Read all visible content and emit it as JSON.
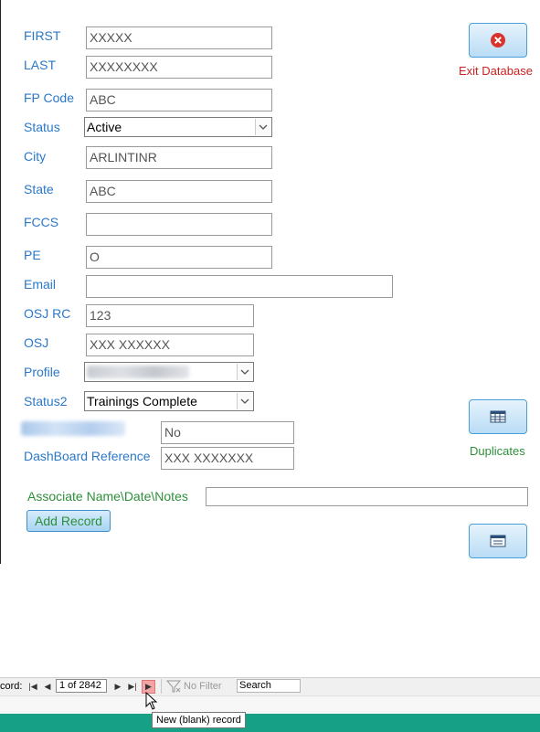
{
  "form": {
    "first": {
      "label": "FIRST",
      "value": "XXXXX"
    },
    "last": {
      "label": "LAST",
      "value": "XXXXXXXX"
    },
    "fp_code": {
      "label": "FP Code",
      "value": "ABC"
    },
    "status": {
      "label": "Status",
      "value": "Active"
    },
    "city": {
      "label": "City",
      "value": "ARLINTINR"
    },
    "state": {
      "label": "State",
      "value": "ABC"
    },
    "fccs": {
      "label": "FCCS",
      "value": ""
    },
    "pe": {
      "label": "PE",
      "value": "O"
    },
    "email": {
      "label": "Email",
      "value": ""
    },
    "osj_rc": {
      "label": "OSJ RC",
      "value": "123"
    },
    "osj": {
      "label": "OSJ",
      "value": "XXX XXXXXX"
    },
    "profile": {
      "label": "Profile",
      "value": ""
    },
    "status2": {
      "label": "Status2",
      "value": "Trainings Complete"
    },
    "blurred_field": {
      "value": "No"
    },
    "dashboard_reference": {
      "label": "DashBoard Reference",
      "value": "XXX XXXXXXX"
    },
    "associate_notes": {
      "label": "Associate Name\\Date\\Notes",
      "value": ""
    }
  },
  "buttons": {
    "exit_caption": "Exit Database",
    "duplicates_caption": "Duplicates",
    "add_record": "Add Record"
  },
  "navigation": {
    "record_label": "cord:",
    "position": "1 of 2842",
    "no_filter": "No Filter",
    "search": "Search"
  },
  "tooltip": "New (blank) record",
  "colors": {
    "label_blue": "#2a78c8",
    "exit_red": "#cc2222",
    "green_caption": "#2e8f3a",
    "status_green_bar": "#16a085"
  }
}
